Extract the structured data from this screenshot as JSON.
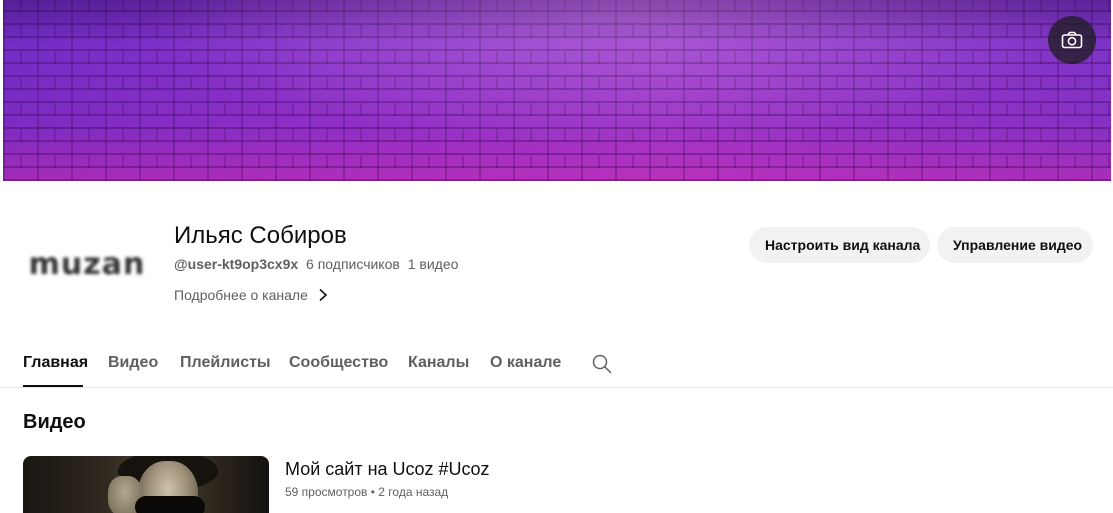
{
  "banner": {
    "camera_icon": "camera-icon"
  },
  "channel": {
    "avatar_text": "muzan",
    "name": "Ильяс Собиров",
    "handle": "@user-kt9op3cx9x",
    "subscribers": "6 подписчиков",
    "videos_count": "1 видео",
    "more_label": "Подробнее о канале",
    "more_icon": "chevron-right-icon"
  },
  "actions": {
    "customize_label": "Настроить вид канала",
    "manage_label": "Управление видео"
  },
  "tabs": [
    {
      "label": "Главная",
      "active": true
    },
    {
      "label": "Видео",
      "active": false
    },
    {
      "label": "Плейлисты",
      "active": false
    },
    {
      "label": "Сообщество",
      "active": false
    },
    {
      "label": "Каналы",
      "active": false
    },
    {
      "label": "О канале",
      "active": false
    }
  ],
  "tabs_search_icon": "search-icon",
  "section": {
    "title": "Видео"
  },
  "video": {
    "title": "Мой сайт на Ucoz #Ucoz",
    "views": "59 просмотров",
    "separator": "•",
    "age": "2 года назад"
  },
  "colors": {
    "banner_primary": "#8a35cf",
    "banner_accent": "#d23fb0",
    "button_bg": "#f2f2f2",
    "text_primary": "#0f0f0f",
    "text_secondary": "#606060"
  }
}
